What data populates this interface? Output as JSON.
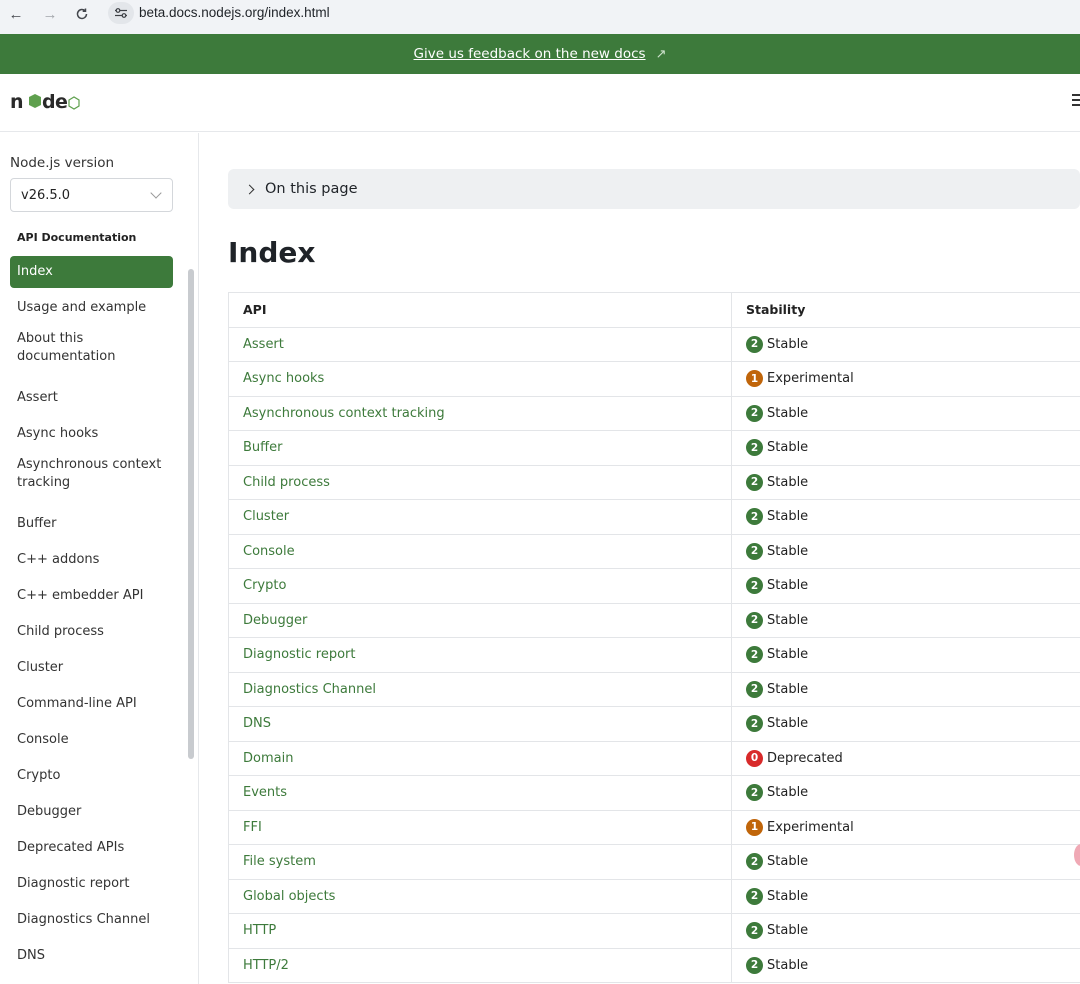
{
  "browser": {
    "url": "beta.docs.nodejs.org/index.html",
    "back_icon": "←",
    "forward_icon": "→",
    "reload_icon": "C",
    "site_info_icon": "⚙"
  },
  "banner": {
    "text": "Give us feedback on the new docs",
    "arrow": "↗",
    "color": "#3d7a3b"
  },
  "header": {
    "logo_text_1": "n",
    "logo_text_2": "d",
    "logo_text_3": "e"
  },
  "sidebar": {
    "version_label": "Node.js version",
    "version_value": "v26.5.0",
    "section_heading": "API Documentation",
    "items": [
      {
        "label": "Index",
        "active": true
      },
      {
        "label": "Usage and example"
      },
      {
        "label": "About this documentation"
      },
      {
        "label": "Assert"
      },
      {
        "label": "Async hooks"
      },
      {
        "label": "Asynchronous context tracking"
      },
      {
        "label": "Buffer"
      },
      {
        "label": "C++ addons"
      },
      {
        "label": "C++ embedder API"
      },
      {
        "label": "Child process"
      },
      {
        "label": "Cluster"
      },
      {
        "label": "Command-line API"
      },
      {
        "label": "Console"
      },
      {
        "label": "Crypto"
      },
      {
        "label": "Debugger"
      },
      {
        "label": "Deprecated APIs"
      },
      {
        "label": "Diagnostic report"
      },
      {
        "label": "Diagnostics Channel"
      },
      {
        "label": "DNS"
      }
    ]
  },
  "main": {
    "on_this_page": "On this page",
    "title": "Index",
    "table": {
      "headers": [
        "API",
        "Stability"
      ],
      "rows": [
        {
          "api": "Assert",
          "level": "2",
          "stability": "Stable"
        },
        {
          "api": "Async hooks",
          "level": "1",
          "stability": "Experimental"
        },
        {
          "api": "Asynchronous context tracking",
          "level": "2",
          "stability": "Stable"
        },
        {
          "api": "Buffer",
          "level": "2",
          "stability": "Stable"
        },
        {
          "api": "Child process",
          "level": "2",
          "stability": "Stable"
        },
        {
          "api": "Cluster",
          "level": "2",
          "stability": "Stable"
        },
        {
          "api": "Console",
          "level": "2",
          "stability": "Stable"
        },
        {
          "api": "Crypto",
          "level": "2",
          "stability": "Stable"
        },
        {
          "api": "Debugger",
          "level": "2",
          "stability": "Stable"
        },
        {
          "api": "Diagnostic report",
          "level": "2",
          "stability": "Stable"
        },
        {
          "api": "Diagnostics Channel",
          "level": "2",
          "stability": "Stable"
        },
        {
          "api": "DNS",
          "level": "2",
          "stability": "Stable"
        },
        {
          "api": "Domain",
          "level": "0",
          "stability": "Deprecated"
        },
        {
          "api": "Events",
          "level": "2",
          "stability": "Stable"
        },
        {
          "api": "FFI",
          "level": "1",
          "stability": "Experimental"
        },
        {
          "api": "File system",
          "level": "2",
          "stability": "Stable"
        },
        {
          "api": "Global objects",
          "level": "2",
          "stability": "Stable"
        },
        {
          "api": "HTTP",
          "level": "2",
          "stability": "Stable"
        },
        {
          "api": "HTTP/2",
          "level": "2",
          "stability": "Stable"
        }
      ]
    }
  },
  "colors": {
    "stable": "#3d7a3b",
    "experimental": "#c0650a",
    "deprecated": "#d82a2a"
  }
}
